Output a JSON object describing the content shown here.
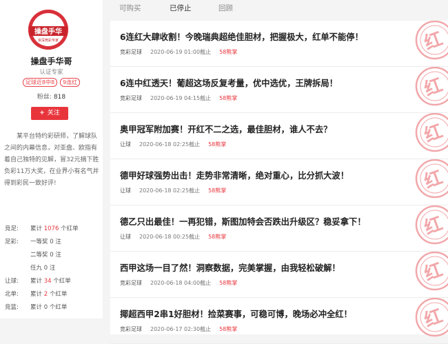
{
  "profile": {
    "avatar_text_top": "操盘手华",
    "avatar_text_bottom": "资深竞彩专家",
    "name": "操盘手华哥",
    "title": "认证专家",
    "badges": [
      "足球近8中8",
      "9连红"
    ],
    "fans_label": "粉丝:",
    "fans_count": "818",
    "follow_label": "关注",
    "bio": "某平台特约彩研师，了解球队之间的内幕信息，对亚盘、欧指有着自己独特的见解，冒32元摘下胜负彩11万大奖，在业界小有名气并得到彩民一致好评!"
  },
  "stats": [
    {
      "label": "竞足:",
      "prefix": "累计",
      "count": "1076",
      "suffix": "个红单",
      "highlight": true
    },
    {
      "label": "足彩:",
      "prefix": "一等奖",
      "count": "0",
      "suffix": "注",
      "highlight": false
    },
    {
      "label": "",
      "prefix": "二等奖",
      "count": "0",
      "suffix": "注",
      "highlight": false
    },
    {
      "label": "",
      "prefix": "任九",
      "count": "0",
      "suffix": "注",
      "highlight": false
    },
    {
      "label": "让球:",
      "prefix": "累计",
      "count": "34",
      "suffix": "个红单",
      "highlight": true
    },
    {
      "label": "北单:",
      "prefix": "累计",
      "count": "2",
      "suffix": "个红单",
      "highlight": true
    },
    {
      "label": "竞篮:",
      "prefix": "累计",
      "count": "0",
      "suffix": "个红单",
      "highlight": false
    }
  ],
  "tabs": [
    {
      "label": "可购买",
      "active": false
    },
    {
      "label": "已停止",
      "active": true
    },
    {
      "label": "回顾",
      "active": false
    }
  ],
  "articles": [
    {
      "title": "6连红大肆收割！今晚瑞典超绝佳胆材，把握极大，红单不能停！",
      "category": "竞彩足球",
      "time": "2020-06-19 01:00截止",
      "price": "58熊掌"
    },
    {
      "title": "6连中红透天！葡超这场反复考量，优中选优，王牌拆局！",
      "category": "竞彩足球",
      "time": "2020-06-19 04:15截止",
      "price": "58熊掌"
    },
    {
      "title": "奥甲冠军附加赛！开红不二之选，最佳胆材，谁人不去？",
      "category": "让球",
      "time": "2020-06-18 02:25截止",
      "price": "58熊掌"
    },
    {
      "title": "德甲好球强势出击！走势非常清晰，绝对重心，比分抓大波！",
      "category": "让球",
      "time": "2020-06-18 02:25截止",
      "price": "58熊掌"
    },
    {
      "title": "德乙只出最佳！一再犯错，斯图加特会否跌出升级区？稳妥拿下！",
      "category": "让球",
      "time": "2020-06-18 00:25截止",
      "price": "58熊掌"
    },
    {
      "title": "西甲这场一目了然！洞察数据，完美掌握，由我轻松破解！",
      "category": "竞彩足球",
      "time": "2020-06-18 04:00截止",
      "price": "58熊掌"
    },
    {
      "title": "揶超西甲2串1好胆材！捡菜赛事，可稳可博，晚场必冲全红！",
      "category": "竞彩足球",
      "time": "2020-06-17 02:30截止",
      "price": "58熊掌"
    }
  ],
  "stamp_char": "红",
  "colors": {
    "accent": "#e8353c",
    "stamp": "#f2a7aa"
  }
}
